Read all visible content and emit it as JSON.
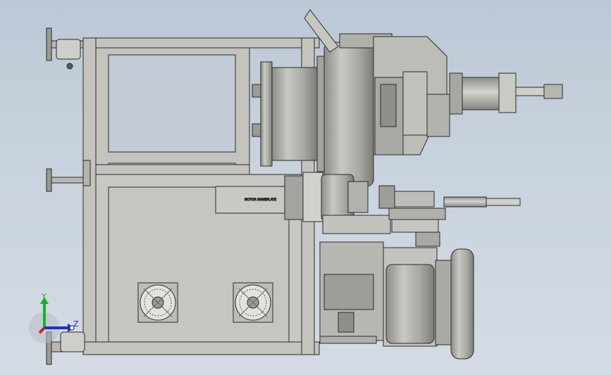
{
  "window": {
    "title": ""
  },
  "colors": {
    "background_top": "#bcc8d6",
    "background_bottom": "#d4dbe4",
    "part_fill": "#b8b8b2",
    "part_light": "#cfcfca",
    "part_dark": "#8c8c86",
    "frame_fill": "#c4c3bd",
    "edge": "#2a2a2a",
    "axis_x": "#d02020",
    "axis_y": "#1fae2a",
    "axis_z": "#1a2fd0"
  },
  "motor_label": "MOTOR NAMEPLATE",
  "triad": {
    "y_label": "Y",
    "z_label": "Z"
  },
  "icons": [
    "leveling-foot-icon",
    "cooling-fan-icon",
    "axis-triad-icon"
  ]
}
